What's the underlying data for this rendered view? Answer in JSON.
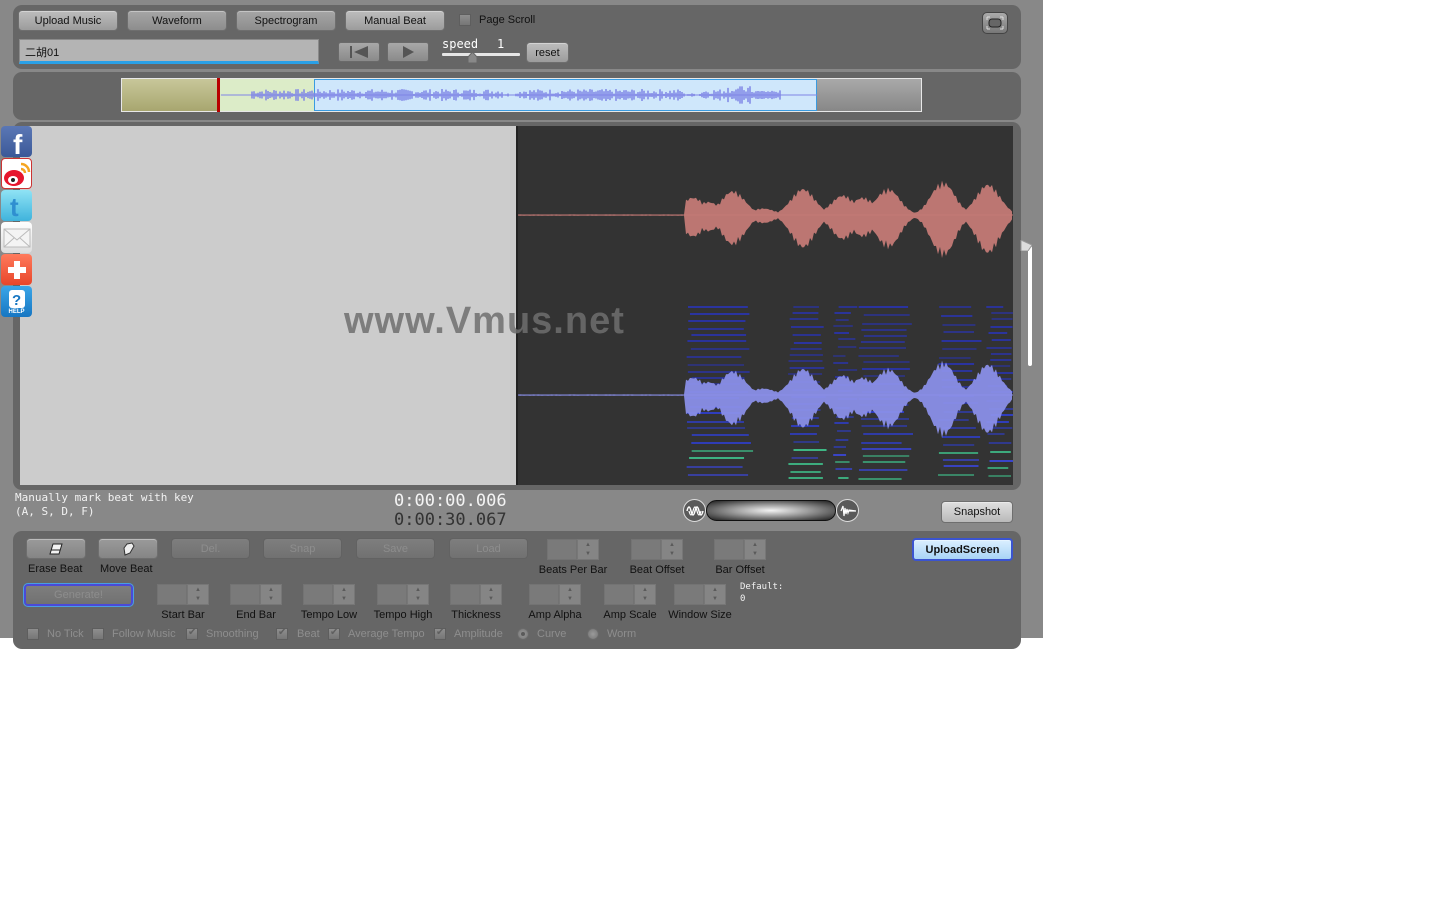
{
  "toolbar": {
    "upload_music": "Upload Music",
    "waveform": "Waveform",
    "spectrogram": "Spectrogram",
    "manual_beat": "Manual Beat",
    "page_scroll_label": "Page Scroll",
    "page_scroll_checked": false,
    "track_title": "二胡01",
    "speed_label": "speed",
    "speed_value": "1",
    "speed_slider_fraction": 0.5,
    "reset": "reset",
    "icons": {
      "rewind": "skip-to-start-icon",
      "play": "play-icon",
      "fullscreen": "fullscreen-icon"
    }
  },
  "overview": {
    "played_fraction": 0.12,
    "view_start_fraction": 0.24,
    "view_end_fraction": 0.87,
    "colors": {
      "wave": "#7f85e6",
      "cursor": "#b80000"
    }
  },
  "main": {
    "watermark": "www.Vmus.net",
    "colors": {
      "waveform": "#c47a76",
      "spectro_wave": "#8a8fe8",
      "left_bg": "#cccccc",
      "right_bg": "#333333"
    }
  },
  "social": [
    {
      "name": "facebook",
      "icon": "facebook-icon"
    },
    {
      "name": "weibo",
      "icon": "weibo-icon"
    },
    {
      "name": "twitter",
      "icon": "twitter-icon"
    },
    {
      "name": "email",
      "icon": "mail-icon"
    },
    {
      "name": "share",
      "icon": "plus-icon"
    },
    {
      "name": "help",
      "icon": "help-icon",
      "label": "HELP"
    }
  ],
  "status": {
    "hint_line1": "Manually mark beat with key",
    "hint_line2": "(A, S, D, F)",
    "current_time": "0:00:00.006",
    "total_time": "0:00:30.067",
    "snapshot": "Snapshot"
  },
  "beat_panel": {
    "erase_beat": "Erase Beat",
    "move_beat": "Move Beat",
    "del": "Del.",
    "snap": "Snap",
    "save": "Save",
    "load": "Load",
    "generate": "Generate!",
    "upload_screen": "UploadScreen",
    "steppers_row1": [
      {
        "label": "Beats Per Bar",
        "value": ""
      },
      {
        "label": "Beat Offset",
        "value": ""
      },
      {
        "label": "Bar Offset",
        "value": ""
      }
    ],
    "steppers_row2": [
      {
        "label": "Start Bar",
        "value": ""
      },
      {
        "label": "End Bar",
        "value": ""
      },
      {
        "label": "Tempo Low",
        "value": ""
      },
      {
        "label": "Tempo High",
        "value": ""
      },
      {
        "label": "Thickness",
        "value": ""
      },
      {
        "label": "Amp Alpha",
        "value": ""
      },
      {
        "label": "Amp Scale",
        "value": ""
      },
      {
        "label": "Window Size",
        "value": ""
      }
    ],
    "default_label": "Default:",
    "default_value": "0",
    "options": [
      {
        "label": "No Tick",
        "type": "checkbox",
        "checked": false
      },
      {
        "label": "Follow Music",
        "type": "checkbox",
        "checked": false
      },
      {
        "label": "Smoothing",
        "type": "checkbox",
        "checked": true
      },
      {
        "label": "Beat",
        "type": "checkbox",
        "checked": true
      },
      {
        "label": "Average Tempo",
        "type": "checkbox",
        "checked": true
      },
      {
        "label": "Amplitude",
        "type": "checkbox",
        "checked": true
      },
      {
        "label": "Curve",
        "type": "radio",
        "checked": true
      },
      {
        "label": "Worm",
        "type": "radio",
        "checked": false
      }
    ]
  }
}
